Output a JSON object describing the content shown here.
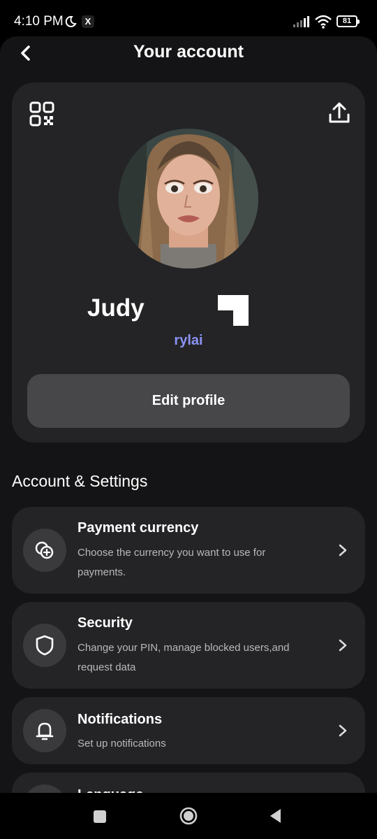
{
  "status_bar": {
    "time": "4:10 PM",
    "x_badge": "X",
    "battery": "81",
    "icons": [
      "moon-icon",
      "x-app-icon",
      "signal-icon",
      "wifi-icon",
      "battery-icon"
    ]
  },
  "header": {
    "title": "Your account",
    "back_icon": "chevron-left-icon"
  },
  "profile": {
    "qr_icon": "qr-code-icon",
    "share_icon": "share-upload-icon",
    "name": "Judy",
    "username": "rylai",
    "edit_button_label": "Edit profile"
  },
  "section": {
    "title": "Account & Settings"
  },
  "settings_items": [
    {
      "title": "Payment currency",
      "description": "Choose the currency you want to use for payments.",
      "icon": "currency-icon"
    },
    {
      "title": "Security",
      "description": "Change your PIN, manage blocked users,and request data",
      "icon": "shield-icon"
    },
    {
      "title": "Notifications",
      "description": "Set up notifications",
      "icon": "bell-icon"
    },
    {
      "title": "Language",
      "description": "",
      "icon": "language-icon"
    }
  ],
  "colors": {
    "background": "#141416",
    "card": "#242426",
    "button": "#47474a",
    "accent_username": "#8b93f5",
    "secondary_text": "#b9b9bd"
  },
  "nav_bar": {
    "icons": [
      "recent-apps-icon",
      "home-icon",
      "back-icon"
    ]
  }
}
